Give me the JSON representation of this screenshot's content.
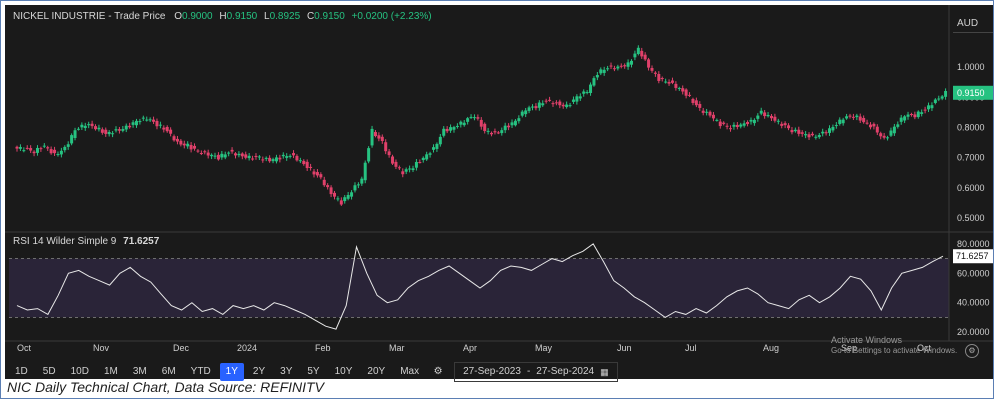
{
  "header": {
    "instrument": "NICKEL INDUSTRIE - Trade Price",
    "o_label": "O",
    "o_value": "0.9000",
    "h_label": "H",
    "h_value": "0.9150",
    "l_label": "L",
    "l_value": "0.8925",
    "c_label": "C",
    "c_value": "0.9150",
    "change": "+0.0200 (+2.23%)"
  },
  "currency": "AUD",
  "last_price_label": "0.9150",
  "rsi_header": {
    "label": "RSI 14 Wilder Simple 9",
    "value": "71.6257"
  },
  "rsi_value_tag": "71.6257",
  "toolbar": {
    "ranges": [
      "1D",
      "5D",
      "10D",
      "1M",
      "3M",
      "6M",
      "YTD",
      "1Y",
      "2Y",
      "3Y",
      "5Y",
      "10Y",
      "20Y",
      "Max"
    ],
    "active": "1Y",
    "date_from": "27-Sep-2023",
    "date_sep": "-",
    "date_to": "27-Sep-2024"
  },
  "watermark": {
    "line1": "Activate Windows",
    "line2": "Go to Settings to activate Windows."
  },
  "caption": "NIC Daily Technical Chart, Data Source: REFINITV",
  "colors": {
    "up": "#26c281",
    "down": "#e0406a",
    "rsi_line": "#e8e8e8",
    "rsi_band": "#2a2438",
    "accent": "#2962ff",
    "change_text": "#26c281"
  },
  "chart_data": [
    {
      "type": "candlestick",
      "title": "NICKEL INDUSTRIE - Trade Price",
      "x_ticks": [
        "Oct",
        "Nov",
        "Dec",
        "2024",
        "Feb",
        "Mar",
        "Apr",
        "May",
        "Jun",
        "Jul",
        "Aug",
        "Sep",
        "Oct"
      ],
      "y_ticks": [
        "1.0000",
        "0.9000",
        "0.8000",
        "0.7000",
        "0.6000",
        "0.5000"
      ],
      "ylim": [
        0.47,
        1.1
      ],
      "close_path": [
        0.73,
        0.72,
        0.74,
        0.71,
        0.73,
        0.79,
        0.81,
        0.8,
        0.78,
        0.79,
        0.8,
        0.82,
        0.83,
        0.81,
        0.79,
        0.75,
        0.74,
        0.72,
        0.71,
        0.7,
        0.72,
        0.71,
        0.7,
        0.7,
        0.69,
        0.7,
        0.71,
        0.69,
        0.66,
        0.63,
        0.58,
        0.55,
        0.59,
        0.63,
        0.79,
        0.75,
        0.68,
        0.65,
        0.67,
        0.7,
        0.73,
        0.79,
        0.8,
        0.82,
        0.84,
        0.79,
        0.78,
        0.8,
        0.82,
        0.86,
        0.87,
        0.89,
        0.88,
        0.87,
        0.9,
        0.92,
        0.98,
        1.0,
        1.0,
        1.01,
        1.06,
        1.0,
        0.96,
        0.95,
        0.93,
        0.9,
        0.86,
        0.84,
        0.81,
        0.8,
        0.81,
        0.82,
        0.85,
        0.83,
        0.81,
        0.79,
        0.78,
        0.77,
        0.78,
        0.8,
        0.83,
        0.84,
        0.82,
        0.8,
        0.76,
        0.8,
        0.84,
        0.84,
        0.86,
        0.89,
        0.915
      ]
    },
    {
      "type": "line",
      "title": "RSI 14 Wilder Simple 9",
      "x_ticks": [
        "Oct",
        "Nov",
        "Dec",
        "2024",
        "Feb",
        "Mar",
        "Apr",
        "May",
        "Jun",
        "Jul",
        "Aug",
        "Sep",
        "Oct"
      ],
      "y_ticks": [
        "80.0000",
        "60.0000",
        "40.0000",
        "20.0000"
      ],
      "ylim": [
        18,
        82
      ],
      "band": [
        30,
        70
      ],
      "values": [
        38,
        35,
        36,
        32,
        45,
        60,
        62,
        58,
        55,
        52,
        60,
        64,
        58,
        54,
        46,
        38,
        35,
        40,
        34,
        36,
        32,
        38,
        36,
        38,
        35,
        40,
        38,
        35,
        32,
        28,
        24,
        22,
        38,
        78,
        60,
        45,
        40,
        42,
        50,
        55,
        58,
        62,
        65,
        60,
        55,
        50,
        55,
        62,
        65,
        64,
        62,
        66,
        70,
        68,
        72,
        75,
        80,
        68,
        55,
        50,
        44,
        40,
        35,
        30,
        34,
        32,
        36,
        33,
        38,
        44,
        48,
        50,
        46,
        40,
        38,
        36,
        42,
        45,
        40,
        44,
        50,
        58,
        56,
        48,
        35,
        50,
        60,
        62,
        64,
        68,
        71.6257
      ]
    }
  ]
}
